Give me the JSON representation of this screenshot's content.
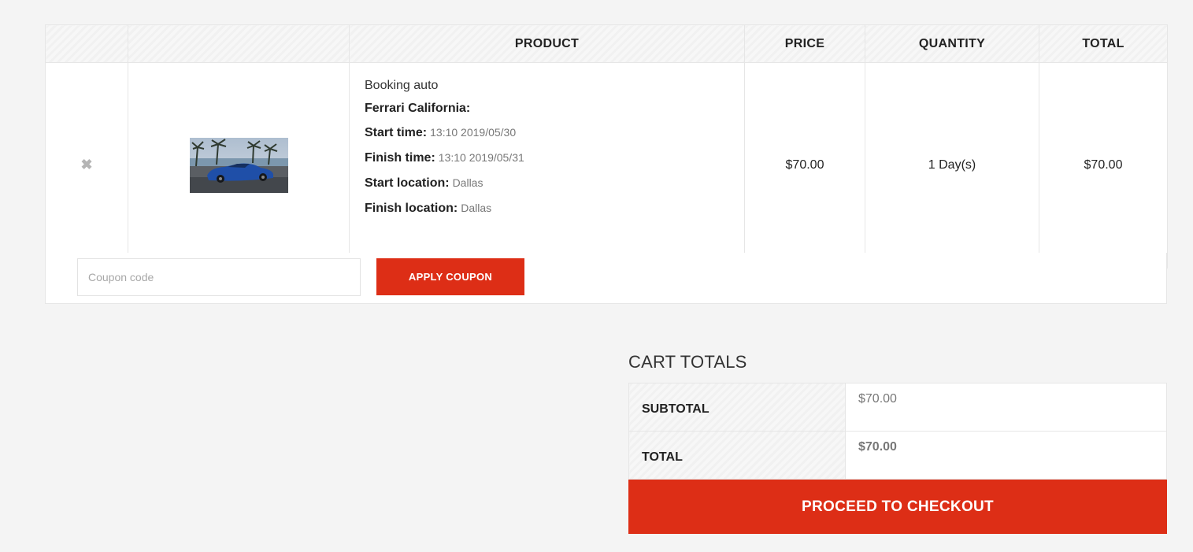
{
  "cart_table": {
    "headers": {
      "remove": "",
      "thumbnail": "",
      "product": "PRODUCT",
      "price": "PRICE",
      "quantity": "QUANTITY",
      "total": "TOTAL"
    },
    "item": {
      "remove_icon": "✖",
      "title": "Booking auto",
      "name": "Ferrari California:",
      "meta": [
        {
          "key": "Start time:",
          "value": "13:10 2019/05/30"
        },
        {
          "key": "Finish time:",
          "value": "13:10 2019/05/31"
        },
        {
          "key": "Start location:",
          "value": "Dallas"
        },
        {
          "key": "Finish location:",
          "value": "Dallas"
        }
      ],
      "price": "$70.00",
      "quantity": "1 Day(s)",
      "total": "$70.00"
    }
  },
  "coupon": {
    "placeholder": "Coupon code",
    "apply_label": "APPLY COUPON"
  },
  "cart_totals": {
    "title": "CART TOTALS",
    "subtotal_label": "SUBTOTAL",
    "subtotal_value": "$70.00",
    "total_label": "TOTAL",
    "total_value": "$70.00"
  },
  "checkout_label": "PROCEED TO CHECKOUT",
  "colors": {
    "accent": "#dd2e16",
    "background": "#f4f4f4"
  }
}
